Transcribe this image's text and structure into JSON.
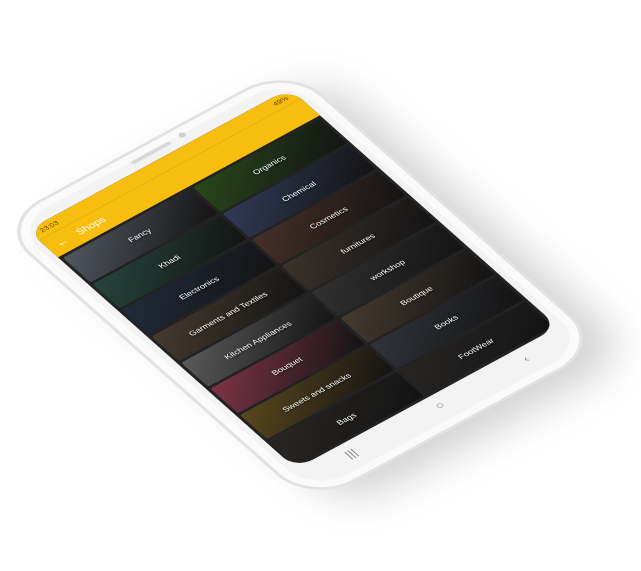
{
  "status": {
    "time": "23:03",
    "battery": "49%"
  },
  "appbar": {
    "title": "Shops"
  },
  "colors": {
    "accent": "#f7bd0f"
  },
  "tiles": [
    {
      "label": "Fancy",
      "color": "#7d8593"
    },
    {
      "label": "Organics",
      "color": "#3f6f2a"
    },
    {
      "label": "Khadi",
      "color": "#3b6b5e"
    },
    {
      "label": "Chemical",
      "color": "#4b5a86"
    },
    {
      "label": "Electronics",
      "color": "#34435a"
    },
    {
      "label": "Cosmetics",
      "color": "#6c4a3f"
    },
    {
      "label": "Garments and Textiles",
      "color": "#6b5a4a"
    },
    {
      "label": "furnitures",
      "color": "#5a4d43"
    },
    {
      "label": "Kitchen Appliances",
      "color": "#8b8b8b"
    },
    {
      "label": "workshop",
      "color": "#4b4b4b"
    },
    {
      "label": "Bouquet",
      "color": "#c0506d"
    },
    {
      "label": "Boutique",
      "color": "#6a5a4b"
    },
    {
      "label": "Sweets and snacks",
      "color": "#8a6d2c"
    },
    {
      "label": "Books",
      "color": "#4a4f59"
    },
    {
      "label": "Bags",
      "color": "#3f3a35"
    },
    {
      "label": "FootWear",
      "color": "#3e3b39"
    }
  ],
  "navbar": {
    "recent": "|||",
    "home": "○",
    "back": "‹"
  }
}
